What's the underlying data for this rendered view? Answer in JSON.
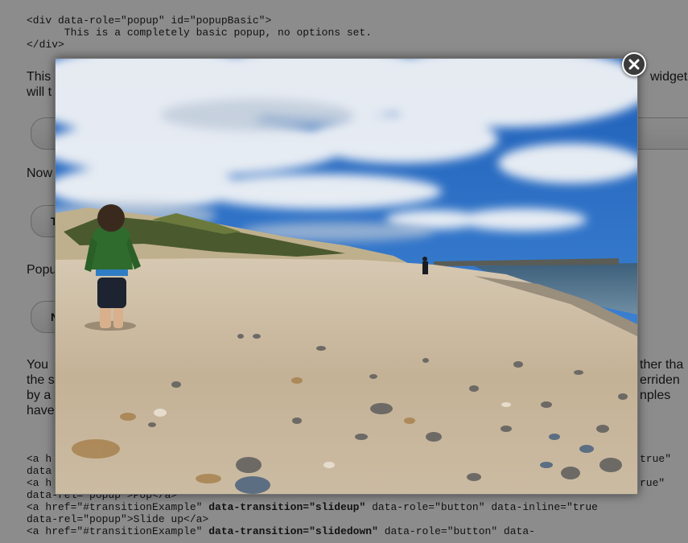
{
  "code_top": [
    "<div data-role=\"popup\" id=\"popupBasic\">",
    "      This is a completely basic popup, no options set.",
    "</div>"
  ],
  "para_1": {
    "left": "This",
    "right": "widgets",
    "line2": "will t"
  },
  "now_label": "Now",
  "now_button": "T",
  "popup_label": "Popu",
  "popup_button": "N",
  "para_2": {
    "left_1": "You",
    "left_2": "the s",
    "left_3": "by a",
    "left_4": "have",
    "right_1": "ther tha",
    "right_2": "erriden",
    "right_3": "nples"
  },
  "code_bottom": {
    "line_1_left": "<a h",
    "line_1_right": "true\"",
    "line_2": "data",
    "line_3_left": "<a h",
    "line_3_right": "rue\"",
    "line_4": "data-rel=\"popup\">Pop</a>",
    "line_5_a": "<a href=\"#transitionExample\" ",
    "line_5_b": "data-transition=\"slideup\"",
    "line_5_c": " data-role=\"button\" data-inline=\"true",
    "line_6": "data-rel=\"popup\">Slide up</a>",
    "line_7_a": "<a href=\"#transitionExample\" ",
    "line_7_b": "data-transition=\"slidedown\"",
    "line_7_c": " data-role=\"button\" data-"
  },
  "popup": {
    "image_subject": "child walking on a pebbled beach under a cloudy sky"
  },
  "close_button": {
    "icon": "close-icon"
  },
  "colors": {
    "overlay": "#00000073",
    "sky": "#2e6fc6",
    "sand": "#c9b9a0",
    "close_bg": "#3b3b3b"
  }
}
